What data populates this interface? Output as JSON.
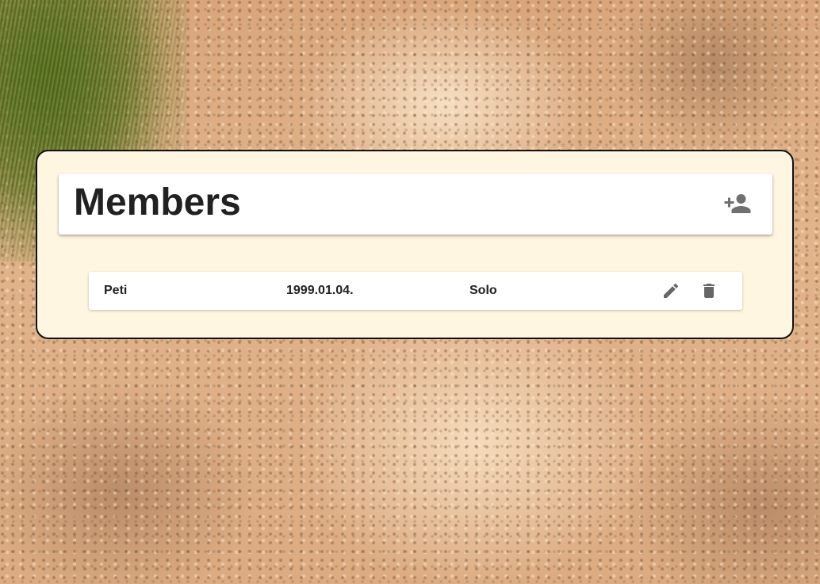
{
  "header": {
    "title": "Members",
    "add_member_icon": "person-add-icon"
  },
  "members": [
    {
      "name": "Peti",
      "date": "1999.01.04.",
      "type": "Solo",
      "edit_icon": "pencil-icon",
      "delete_icon": "trash-icon"
    }
  ],
  "colors": {
    "panel_background": "#fff6e2",
    "panel_border": "#111111",
    "card_background": "#ffffff",
    "title_text": "#212121",
    "icon": "#707070"
  }
}
